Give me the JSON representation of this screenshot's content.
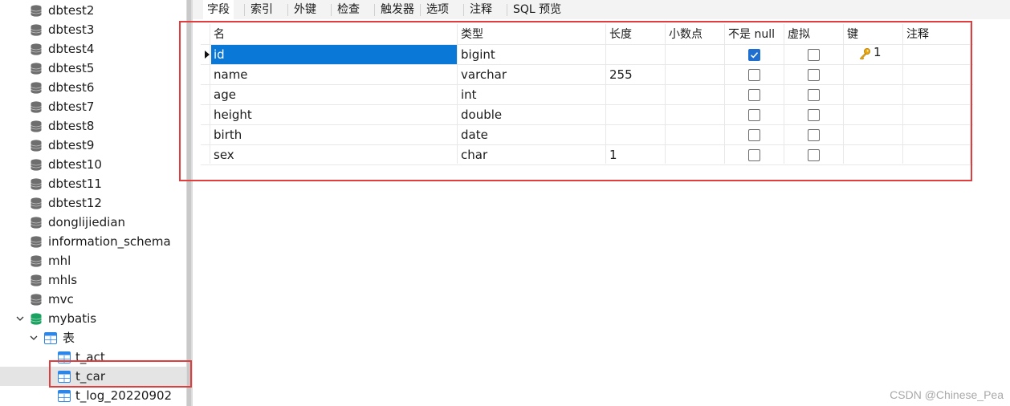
{
  "sidebar": {
    "databases": [
      {
        "label": "dbtest2"
      },
      {
        "label": "dbtest3"
      },
      {
        "label": "dbtest4"
      },
      {
        "label": "dbtest5"
      },
      {
        "label": "dbtest6"
      },
      {
        "label": "dbtest7"
      },
      {
        "label": "dbtest8"
      },
      {
        "label": "dbtest9"
      },
      {
        "label": "dbtest10"
      },
      {
        "label": "dbtest11"
      },
      {
        "label": "dbtest12"
      },
      {
        "label": "donglijiedian"
      },
      {
        "label": "information_schema"
      },
      {
        "label": "mhl"
      },
      {
        "label": "mhls"
      },
      {
        "label": "mvc"
      }
    ],
    "open_database": {
      "label": "mybatis",
      "expanded": true,
      "color": "#1aa260"
    },
    "tables_folder": {
      "label": "表",
      "expanded": true
    },
    "tables": [
      {
        "label": "t_act",
        "selected": false
      },
      {
        "label": "t_car",
        "selected": true
      },
      {
        "label": "t_log_20220902",
        "selected": false
      }
    ],
    "icons": {
      "database": "database-icon",
      "table": "table-icon",
      "folder": "tables-folder-icon"
    },
    "colors": {
      "selected_row": "#e4e4e4",
      "db_icon": "#6e6e6e",
      "table_icon": "#2b86e8"
    }
  },
  "tabs": [
    {
      "label": "字段",
      "active": true
    },
    {
      "label": "索引",
      "active": false
    },
    {
      "label": "外键",
      "active": false
    },
    {
      "label": "检查",
      "active": false
    },
    {
      "label": "触发器",
      "active": false
    },
    {
      "label": "选项",
      "active": false
    },
    {
      "label": "注释",
      "active": false
    },
    {
      "label": "SQL 预览",
      "active": false
    }
  ],
  "grid": {
    "columns": [
      "名",
      "类型",
      "长度",
      "小数点",
      "不是 null",
      "虚拟",
      "键",
      "注释"
    ],
    "rows": [
      {
        "name": "id",
        "type": "bigint",
        "length": "",
        "decimals": "",
        "not_null": true,
        "virtual": false,
        "key": "1",
        "comment": "",
        "current": true
      },
      {
        "name": "name",
        "type": "varchar",
        "length": "255",
        "decimals": "",
        "not_null": false,
        "virtual": false,
        "key": "",
        "comment": "",
        "current": false
      },
      {
        "name": "age",
        "type": "int",
        "length": "",
        "decimals": "",
        "not_null": false,
        "virtual": false,
        "key": "",
        "comment": "",
        "current": false
      },
      {
        "name": "height",
        "type": "double",
        "length": "",
        "decimals": "",
        "not_null": false,
        "virtual": false,
        "key": "",
        "comment": "",
        "current": false
      },
      {
        "name": "birth",
        "type": "date",
        "length": "",
        "decimals": "",
        "not_null": false,
        "virtual": false,
        "key": "",
        "comment": "",
        "current": false
      },
      {
        "name": "sex",
        "type": "char",
        "length": "1",
        "decimals": "",
        "not_null": false,
        "virtual": false,
        "key": "",
        "comment": "",
        "current": false
      }
    ],
    "key_icon": "key-icon"
  },
  "annotations": {
    "highlight_color": "#e03e3e"
  },
  "watermark": "CSDN @Chinese_Pea"
}
